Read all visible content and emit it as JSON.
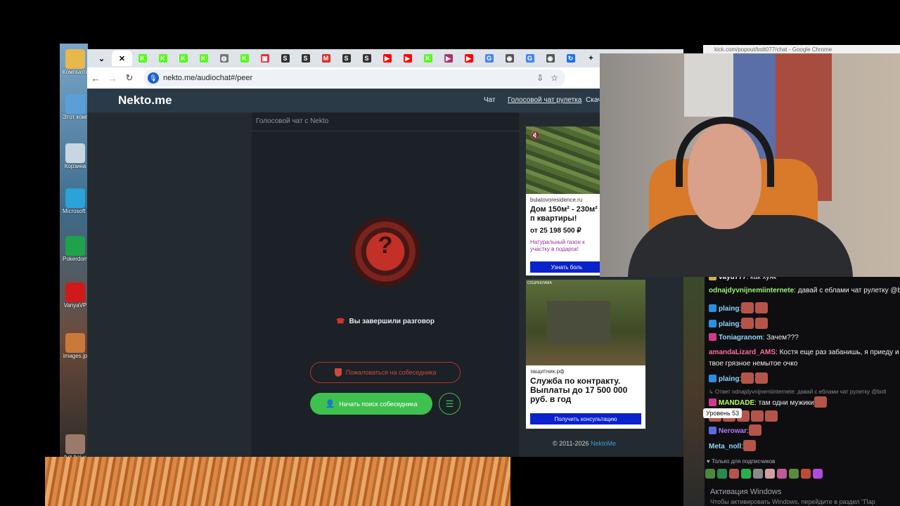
{
  "desktop": {
    "icons": [
      {
        "label": "Компьютер",
        "icon": "folder-icon",
        "color": "#e8b84a"
      },
      {
        "label": "Этот компьютер",
        "icon": "computer-icon",
        "color": "#5aa0d8"
      },
      {
        "label": "Корзина",
        "icon": "recycle-bin-icon",
        "color": "#c8d6e0"
      },
      {
        "label": "Microsoft Edge",
        "icon": "edge-icon",
        "color": "#2aa3d8"
      },
      {
        "label": "Pokerdom",
        "icon": "pokerdom-icon",
        "color": "#1ea34a"
      },
      {
        "label": "VanyaVP",
        "icon": "vanyavp-icon",
        "color": "#d01a1a"
      },
      {
        "label": "images.jp",
        "icon": "image-file-icon",
        "color": "#c97a3a"
      },
      {
        "label": "tuz-hai-v",
        "icon": "image-file-icon",
        "color": "#9a7a6a"
      }
    ]
  },
  "browser": {
    "tabs": [
      {
        "icon": "kick-icon",
        "color": "#53fc18",
        "glyph": "K"
      },
      {
        "icon": "kick-icon",
        "color": "#53fc18",
        "glyph": "K"
      },
      {
        "icon": "kick-icon",
        "color": "#53fc18",
        "glyph": "K"
      },
      {
        "icon": "kick-icon",
        "color": "#53fc18",
        "glyph": "K"
      },
      {
        "icon": "globe-icon",
        "color": "#777777",
        "glyph": "◍"
      },
      {
        "icon": "kick-icon",
        "color": "#53fc18",
        "glyph": "K"
      },
      {
        "icon": "red-icon",
        "color": "#e0343a",
        "glyph": "▣"
      },
      {
        "icon": "s-icon",
        "color": "#333333",
        "glyph": "S"
      },
      {
        "icon": "s-icon",
        "color": "#333333",
        "glyph": "S"
      },
      {
        "icon": "gmail-icon",
        "color": "#d93025",
        "glyph": "M"
      },
      {
        "icon": "s-icon",
        "color": "#333333",
        "glyph": "S"
      },
      {
        "icon": "s-icon",
        "color": "#333333",
        "glyph": "S"
      },
      {
        "icon": "youtube-icon",
        "color": "#ff0000",
        "glyph": "▶"
      },
      {
        "icon": "youtube-icon",
        "color": "#ff0000",
        "glyph": "▶"
      },
      {
        "icon": "kick-icon",
        "color": "#53fc18",
        "glyph": "K"
      },
      {
        "icon": "play-icon",
        "color": "#b0306a",
        "glyph": "▶"
      },
      {
        "icon": "youtube-icon",
        "color": "#ff0000",
        "glyph": "▶"
      },
      {
        "icon": "google-icon",
        "color": "#4285f4",
        "glyph": "G"
      },
      {
        "icon": "chrome-icon",
        "color": "#555555",
        "glyph": "◉"
      },
      {
        "icon": "google-icon",
        "color": "#4285f4",
        "glyph": "G"
      },
      {
        "icon": "chrome-icon",
        "color": "#555555",
        "glyph": "◉"
      },
      {
        "icon": "history-icon",
        "color": "#1a73e8",
        "glyph": "↻"
      }
    ],
    "url": "nekto.me/audiochat#/peer"
  },
  "site": {
    "logo": "Nekto.me",
    "nav": {
      "chat": "Чат",
      "voice": "Голосовой чат рулетка",
      "download": "Скача"
    },
    "chat_title": "Голосовой чат с Nekto",
    "ended_text": "Вы завершили разговор",
    "complain_button": "Пожаловаться на собеседника",
    "start_button": "Начать поиск собеседника",
    "question_mark": "?",
    "copyright": "© 2011-2026 ",
    "copyright_link": "NektoMe"
  },
  "ads": {
    "ad1": {
      "source": "bulatovoresidence.ru",
      "title": "Дом 150м² - 230м² п квартиры!",
      "price": "от 25 198 500 ₽",
      "gift": "Натуральный газон к участку в подарок!",
      "button": "Узнать боль"
    },
    "ad2": {
      "badge": "СОЦРЕКЛАМА",
      "source": "защитник.рф",
      "title": "Служба по контракту. Выплаты до 17 500 000 руб. в год",
      "button": "Получить консультацию"
    }
  },
  "webcam": {
    "popout_url": "kick.com/popout/bolt077/chat - Google Chrome"
  },
  "chat": {
    "messages": [
      {
        "user": "vayu777",
        "user_color": "#efeff1",
        "text": ": как хуяк",
        "emotes": 0,
        "badge": "#c9b24a"
      },
      {
        "user": "odnajdyvnijnemiinternete",
        "user_color": "#9cf57a",
        "text": ": давай с еблами чат рулетку @bo",
        "emotes": 0,
        "badge": ""
      },
      {
        "user": "plaing",
        "user_color": "#8fd5ff",
        "text": ":",
        "emotes": 2,
        "badge": "#2a8fe0"
      },
      {
        "user": "plaing",
        "user_color": "#8fd5ff",
        "text": ":",
        "emotes": 2,
        "badge": "#2a8fe0"
      },
      {
        "user": "Toniagranom",
        "user_color": "#8fd5ff",
        "text": ": Зачем???",
        "emotes": 0,
        "badge": "#d03a8a"
      },
      {
        "user": "amandaLizard_AMS",
        "user_color": "#ff6a9a",
        "text": ": Костя еще раз забанишь, я приеду и в",
        "emotes": 0,
        "badge": ""
      },
      {
        "user": "",
        "user_color": "#efeff1",
        "text": "твое грязное немытое очко",
        "emotes": 0,
        "badge": ""
      },
      {
        "user": "plaing",
        "user_color": "#8fd5ff",
        "text": ":",
        "emotes": 2,
        "badge": "#2a8fe0"
      },
      {
        "user": "",
        "user_color": "#888888",
        "text": "↳ Ответ odnajdyvnijnemiinternete: давай с еблами чат рулетку @bolt",
        "emotes": 0,
        "badge": ""
      },
      {
        "user": "MANDADE",
        "user_color": "#b2ff59",
        "text": ": там одни мужики",
        "emotes": 1,
        "badge": "#d03a8a"
      },
      {
        "user": "",
        "user_color": "#efeff1",
        "text": "",
        "emotes": 5,
        "badge": ""
      },
      {
        "user": "Nerowar",
        "user_color": "#b07aff",
        "text": ":",
        "emotes": 1,
        "badge": "#5a6adf"
      },
      {
        "user": "Meta_noll",
        "user_color": "#8fd5ff",
        "text": ":",
        "emotes": 1,
        "badge": ""
      }
    ],
    "tooltip": "Уровень 53",
    "subs_only": "Только для подписчиков",
    "activate_title": "Активация Windows",
    "activate_sub": "Чтобы активировать Windows, перейдите в раздел \"Пар"
  }
}
